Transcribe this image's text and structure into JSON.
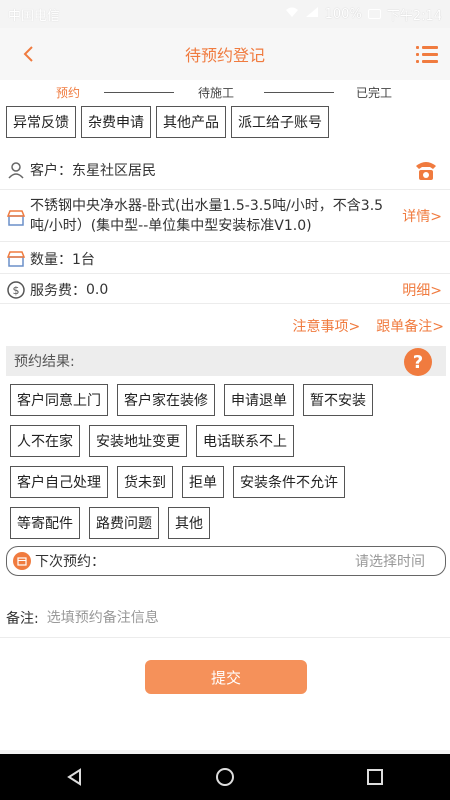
{
  "statusbar": {
    "carrier": "中国电信",
    "battery": "100%",
    "time": "下午2:14"
  },
  "header": {
    "title": "待预约登记",
    "back_glyph": "<"
  },
  "steps": {
    "items": [
      "预约",
      "待施工",
      "已完工"
    ],
    "active_index": 0
  },
  "actions": [
    "异常反馈",
    "杂费申请",
    "其他产品",
    "派工给子账号"
  ],
  "customer": {
    "label": "客户：",
    "value": "东星社区居民"
  },
  "product": {
    "name": "不锈钢中央净水器-卧式(出水量1.5-3.5吨/小时，不含3.5吨/小时）(集中型--单位集中型安装标准V1.0)",
    "detail_link": "详情>"
  },
  "quantity": {
    "label": "数量：",
    "value": "1台"
  },
  "service_fee": {
    "label": "服务费：",
    "value": "0.0",
    "detail_link": "明细>"
  },
  "links": {
    "notice": "注意事项>",
    "follow": "跟单备注>"
  },
  "result": {
    "title": "预约结果:",
    "options_rows": [
      [
        "客户同意上门",
        "客户家在装修",
        "申请退单",
        "暂不安装"
      ],
      [
        "人不在家",
        "安装地址变更",
        "电话联系不上"
      ],
      [
        "客户自己处理",
        "货未到",
        "拒单",
        "安装条件不允许"
      ],
      [
        "等寄配件",
        "路费问题",
        "其他"
      ]
    ]
  },
  "next_appointment": {
    "label": "下次预约：",
    "placeholder": "请选择时间"
  },
  "remark": {
    "label": "备注:",
    "placeholder": "选填预约备注信息"
  },
  "submit_label": "提交",
  "colors": {
    "accent": "#f07b3f",
    "button": "#f5915a"
  }
}
